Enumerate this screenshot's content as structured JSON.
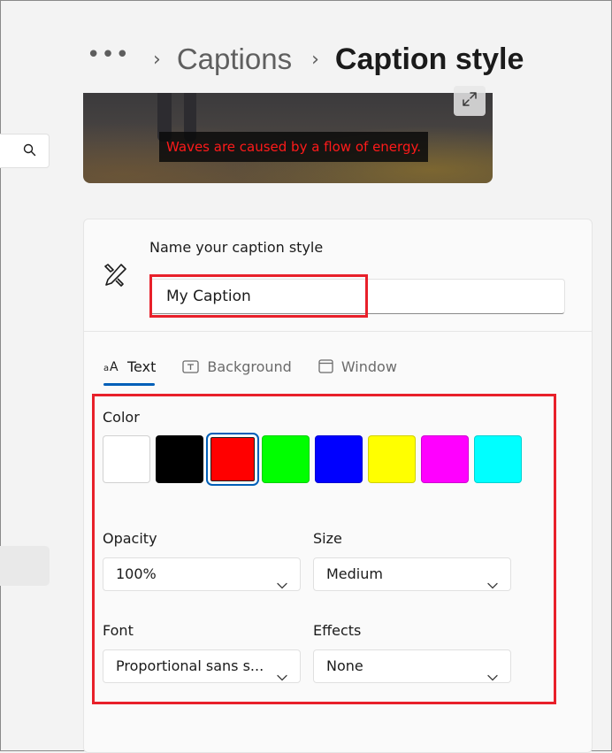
{
  "breadcrumb": {
    "more": "•••",
    "parent": "Captions",
    "current": "Caption style"
  },
  "preview": {
    "caption_text": "Waves are caused by a flow of energy."
  },
  "form": {
    "name_label": "Name your caption style",
    "name_value": "My Caption"
  },
  "tabs": [
    {
      "label": "Text",
      "icon": "text-size-icon"
    },
    {
      "label": "Background",
      "icon": "text-box-icon"
    },
    {
      "label": "Window",
      "icon": "window-icon"
    }
  ],
  "text_settings": {
    "color_label": "Color",
    "colors": [
      "#ffffff",
      "#000000",
      "#ff0000",
      "#00ff00",
      "#0000ff",
      "#ffff00",
      "#ff00ff",
      "#00ffff"
    ],
    "selected_color": "#ff0000",
    "opacity_label": "Opacity",
    "opacity_value": "100%",
    "size_label": "Size",
    "size_value": "Medium",
    "font_label": "Font",
    "font_value": "Proportional sans s...",
    "effects_label": "Effects",
    "effects_value": "None"
  },
  "colors": {
    "accent": "#005fb8",
    "highlight": "#e8202a",
    "caption_text": "#ff1a1a"
  }
}
